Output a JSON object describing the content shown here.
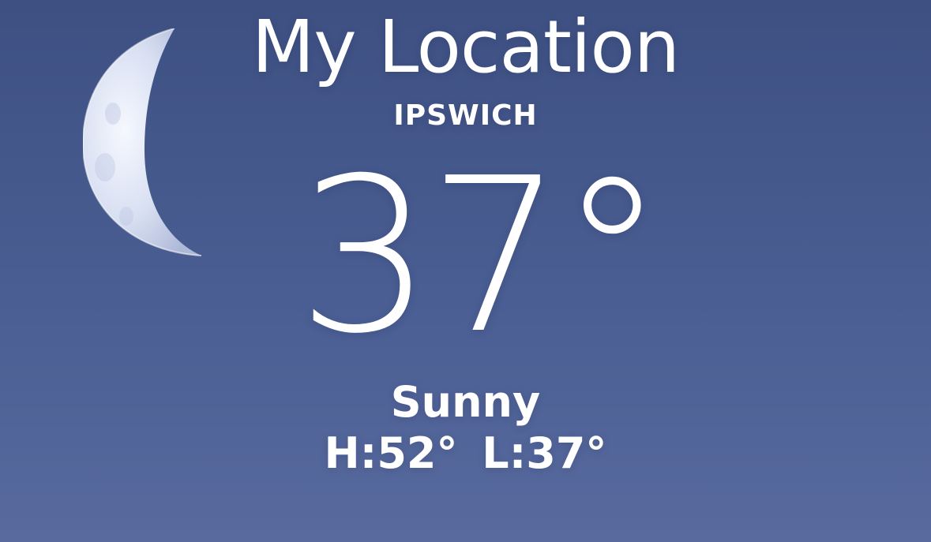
{
  "weather": {
    "title": "My Location",
    "city": "IPSWICH",
    "temperature": "37°",
    "condition": "Sunny",
    "high_low": "H:52°  L:37°"
  },
  "visuals": {
    "moon_icon": "waning-crescent-moon-icon",
    "background_color": "#4a5e93"
  }
}
